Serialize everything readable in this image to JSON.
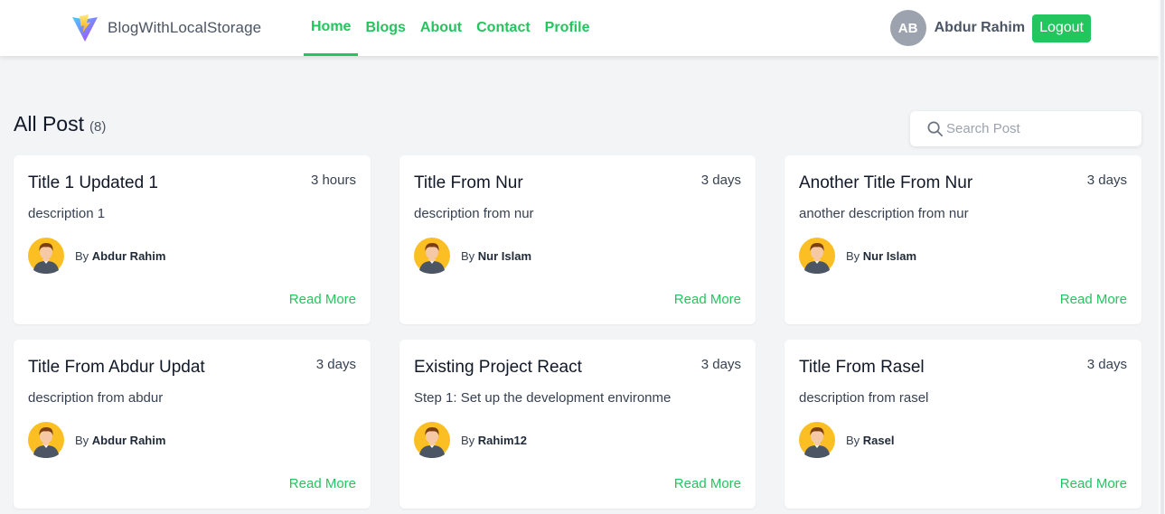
{
  "brand": {
    "name": "BlogWithLocalStorage"
  },
  "nav": {
    "items": [
      {
        "label": "Home",
        "active": true
      },
      {
        "label": "Blogs",
        "active": false
      },
      {
        "label": "About",
        "active": false
      },
      {
        "label": "Contact",
        "active": false
      },
      {
        "label": "Profile",
        "active": false
      }
    ]
  },
  "user": {
    "initials": "AB",
    "name": "Abdur Rahim",
    "logout_label": "Logout"
  },
  "main": {
    "title": "All Post",
    "count": "(8)",
    "search": {
      "placeholder": "Search Post",
      "value": ""
    },
    "by_label": "By",
    "read_more_label": "Read More",
    "posts": [
      {
        "title": "Title 1 Updated 1",
        "time": "3 hours",
        "description": "description 1",
        "author": "Abdur Rahim"
      },
      {
        "title": "Title From Nur",
        "time": "3 days",
        "description": "description from nur",
        "author": "Nur Islam"
      },
      {
        "title": "Another Title From Nur",
        "time": "3 days",
        "description": "another description from nur",
        "author": "Nur Islam"
      },
      {
        "title": "Title From Abdur Updat",
        "time": "3 days",
        "description": "description from abdur",
        "author": "Abdur Rahim"
      },
      {
        "title": "Existing Project React",
        "time": "3 days",
        "description": "Step 1: Set up the development environme",
        "author": "Rahim12"
      },
      {
        "title": "Title From Rasel",
        "time": "3 days",
        "description": "description from rasel",
        "author": "Rasel"
      }
    ]
  },
  "icons": {
    "logo": "vite-logo-icon",
    "search": "search-icon",
    "author_avatar": "user-avatar-icon"
  },
  "colors": {
    "accent": "#22c55e",
    "background": "#f3f4f6",
    "avatar_bg": "#fbbf24",
    "initials_bg": "#9ca3af"
  }
}
